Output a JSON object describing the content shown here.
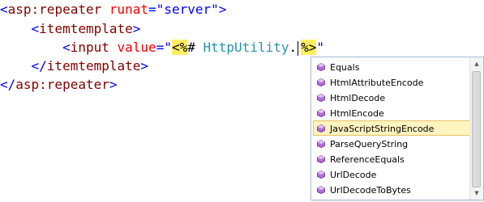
{
  "code": {
    "line1": {
      "open": "<",
      "tag": "asp:repeater",
      "attr": "runat",
      "eq": "=",
      "value": "\"server\"",
      "close": ">"
    },
    "line2": {
      "open": "<",
      "tag": "itemtemplate",
      "close": ">"
    },
    "line3": {
      "open": "<",
      "tag": "input",
      "attr": "value",
      "eq": "=",
      "quote_open": "\"",
      "delim_open": "<%",
      "hash": "#",
      "expr": "HttpUtility",
      "dot": ".",
      "delim_close": "%>",
      "quote_close": "\""
    },
    "line4": {
      "open": "</",
      "tag": "itemtemplate",
      "close": ">"
    },
    "line5": {
      "open": "</",
      "tag": "asp:repeater",
      "close": ">"
    }
  },
  "intellisense": {
    "item_icon": "method-icon",
    "items": [
      {
        "label": "Equals"
      },
      {
        "label": "HtmlAttributeEncode"
      },
      {
        "label": "HtmlDecode"
      },
      {
        "label": "HtmlEncode"
      },
      {
        "label": "JavaScriptStringEncode",
        "selected": true
      },
      {
        "label": "ParseQueryString"
      },
      {
        "label": "ReferenceEquals"
      },
      {
        "label": "UrlDecode"
      },
      {
        "label": "UrlDecodeToBytes"
      }
    ],
    "scroll_up_icon": "scroll-up-arrow-icon",
    "scroll_down_icon": "scroll-down-arrow-icon"
  },
  "colors": {
    "tag": "#800000",
    "punctuation": "#0000ff",
    "attribute": "#ff0000",
    "string": "#0000ff",
    "type": "#2b91af",
    "delimiter_highlight": "#ffee62",
    "selection_fill": "#fdf4bf",
    "selection_border": "#e5c365"
  }
}
